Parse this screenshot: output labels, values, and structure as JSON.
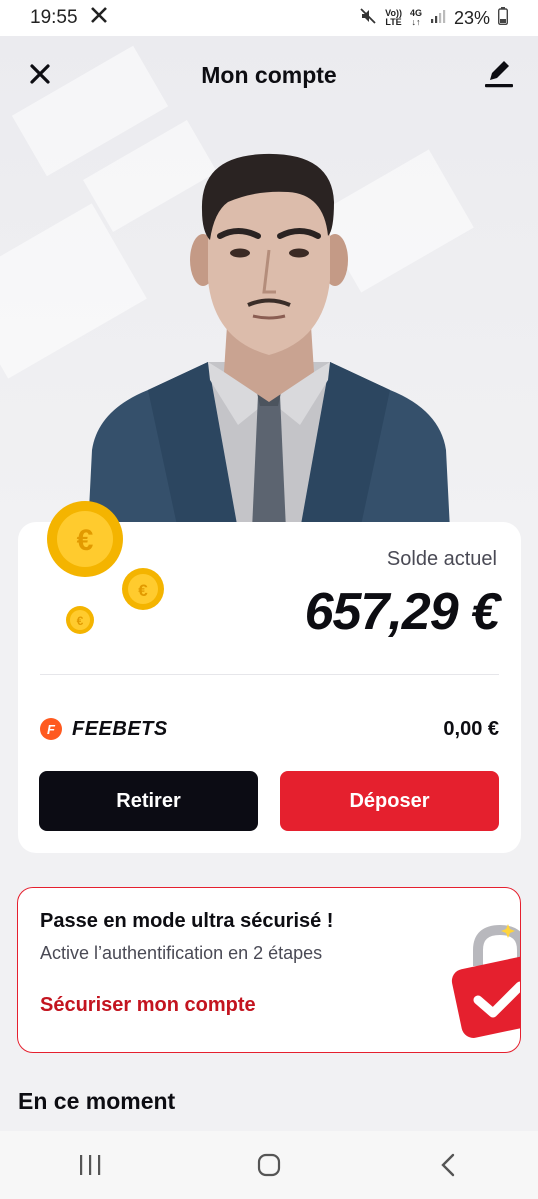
{
  "status_bar": {
    "time": "19:55",
    "app_icon": "x-logo-icon",
    "network_top": "Vo))",
    "network_bottom": "LTE",
    "data_top": "4G",
    "data_bottom": "↓↑",
    "battery": "23%"
  },
  "header": {
    "title": "Mon compte",
    "close_icon": "close-icon",
    "edit_icon": "edit-icon"
  },
  "balance": {
    "label": "Solde actuel",
    "amount": "657,29 €",
    "feebets_logo": "F",
    "feebets_name": "FEEBETS",
    "feebets_amount": "0,00 €",
    "withdraw_label": "Retirer",
    "deposit_label": "Déposer"
  },
  "security": {
    "title": "Passe en mode ultra sécurisé !",
    "subtitle": "Active l’authentification en 2 étapes",
    "link": "Sécuriser mon compte"
  },
  "section": {
    "title": "En ce moment"
  },
  "colors": {
    "accent_red": "#e5202e",
    "dark": "#0c0c14",
    "feebets_orange": "#ff5a1f"
  }
}
